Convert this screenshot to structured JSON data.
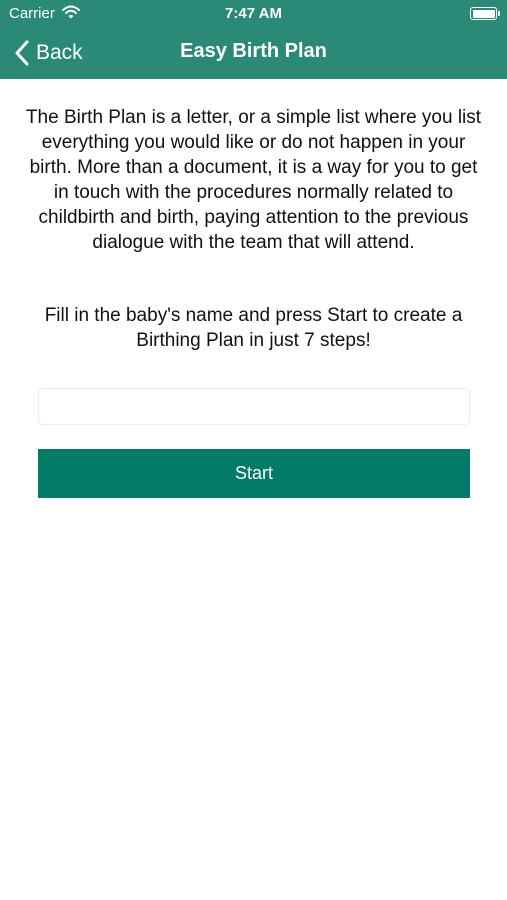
{
  "status_bar": {
    "carrier": "Carrier",
    "time": "7:47 AM",
    "wifi_icon": "wifi-icon",
    "battery_icon": "battery-full-icon"
  },
  "nav_bar": {
    "back_label": "Back",
    "back_icon": "chevron-left-icon",
    "title": "Easy Birth Plan"
  },
  "main": {
    "intro": "The Birth Plan is a letter, or a simple list where you list everything you would like or do not happen in your birth. More than a document, it is a way for you to get in touch with the procedures normally related to childbirth and birth, paying attention to the previous dialogue with the team that will attend.",
    "instruction": "Fill in the baby's name and press Start to create a Birthing Plan in just 7 steps!",
    "name_input": {
      "value": "",
      "placeholder": ""
    },
    "start_label": "Start"
  },
  "colors": {
    "header": "#2a8a77",
    "button": "#047a68",
    "background": "#ffffff",
    "text": "#111111"
  }
}
